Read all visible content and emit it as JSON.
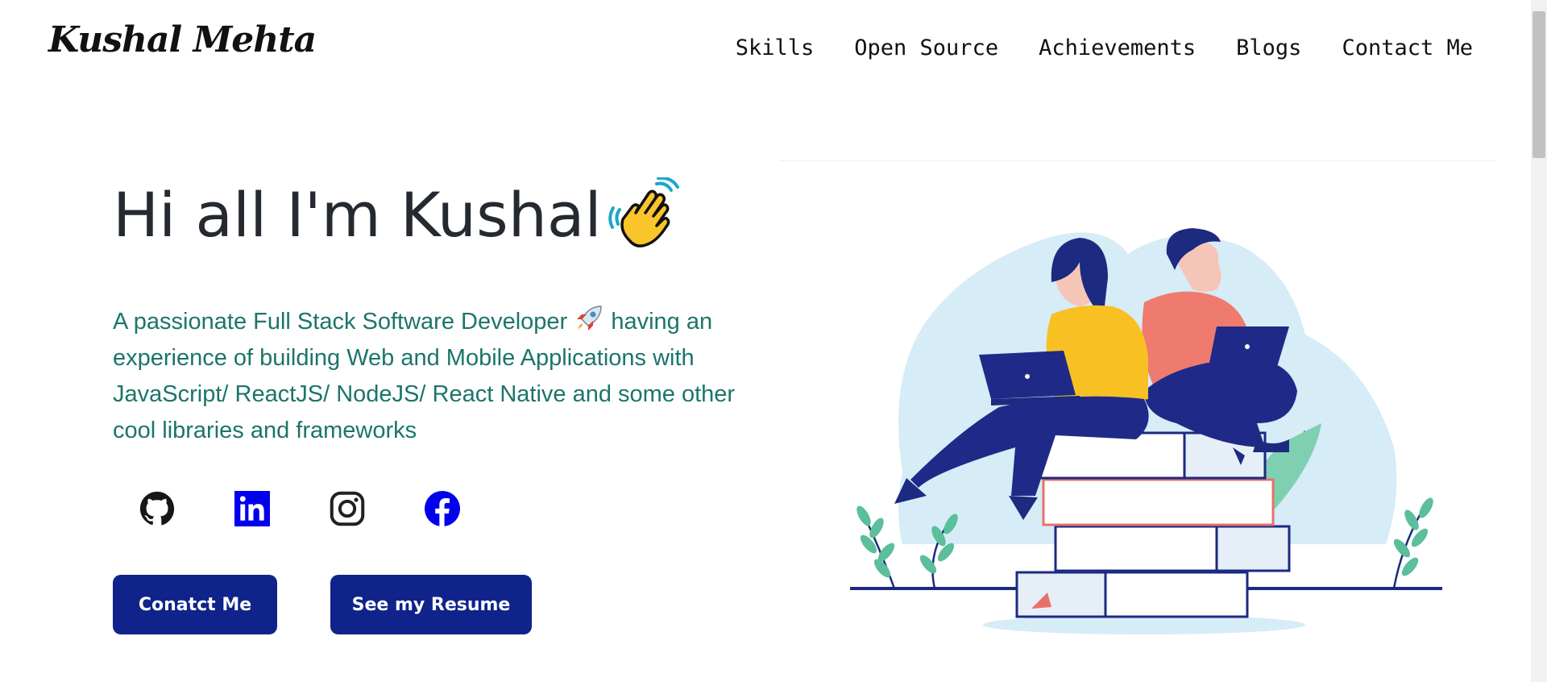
{
  "header": {
    "logo": "Kushal Mehta",
    "nav": [
      {
        "label": "Skills"
      },
      {
        "label": "Open Source"
      },
      {
        "label": "Achievements"
      },
      {
        "label": "Blogs"
      },
      {
        "label": "Contact Me"
      }
    ]
  },
  "hero": {
    "greeting": "Hi all I'm Kushal",
    "greeting_emoji": "waving-hand-icon",
    "subtitle_part1": "A passionate Full Stack Software Developer",
    "subtitle_emoji": "rocket-icon",
    "subtitle_part2": "having an experience of building Web and Mobile Applications with JavaScript/ ReactJS/ NodeJS/ React Native and some other cool libraries and frameworks",
    "socials": [
      {
        "icon": "github-icon"
      },
      {
        "icon": "linkedin-icon"
      },
      {
        "icon": "instagram-icon"
      },
      {
        "icon": "facebook-icon"
      }
    ],
    "buttons": {
      "contact": "Conatct Me",
      "resume": "See my Resume"
    }
  },
  "colors": {
    "accent_button": "#0f238a",
    "subtitle_text": "#1b756b",
    "heading_text": "#242a30",
    "linkedin": "#0000ee",
    "facebook": "#0000ee"
  }
}
